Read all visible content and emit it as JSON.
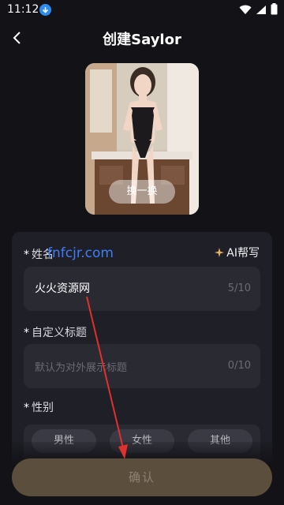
{
  "status": {
    "time": "11:12"
  },
  "header": {
    "title": "创建Saylor"
  },
  "avatar": {
    "swap_label": "换一换"
  },
  "form": {
    "name": {
      "label": "姓名",
      "value": "火火资源网",
      "count": "5/10"
    },
    "ai_help": "AI帮写",
    "custom_title": {
      "label": "自定义标题",
      "placeholder": "默认为对外展示标题",
      "count": "0/10"
    },
    "gender": {
      "label": "性别",
      "options": [
        "男性",
        "女性",
        "其他"
      ]
    }
  },
  "watermark": "fnfcjr.com",
  "confirm_label": "确认",
  "colors": {
    "background": "#121217",
    "panel": "#1f1f27",
    "field": "#2a2a33",
    "confirm": "#5c4e3d",
    "accent_watermark": "#3f7df5",
    "arrow": "#e0312c"
  }
}
